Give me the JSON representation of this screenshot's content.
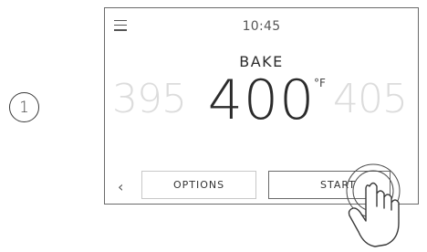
{
  "step": {
    "number": "1"
  },
  "header": {
    "time": "10:45",
    "menu_icon": "hamburger-menu-icon"
  },
  "mode": {
    "label": "BAKE"
  },
  "temperature": {
    "previous": "395",
    "current": "400",
    "next": "405",
    "unit": "°F"
  },
  "footer": {
    "back_icon": "chevron-left-icon",
    "options_label": "OPTIONS",
    "start_label": "START"
  },
  "overlay": {
    "touch_icon": "tap-hand-icon"
  }
}
